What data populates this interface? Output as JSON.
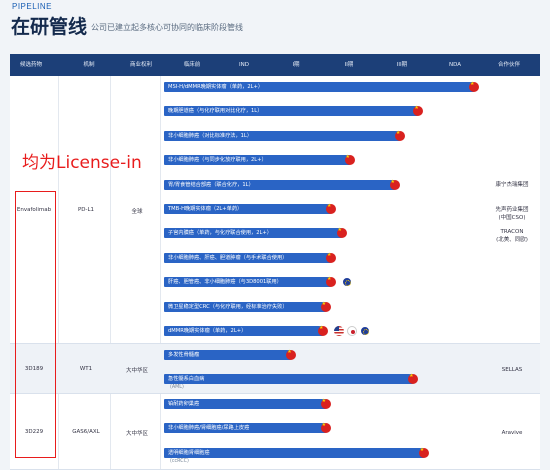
{
  "header": {
    "kicker": "PIPELINE",
    "title": "在研管线",
    "subtitle": "公司已建立起多核心可协同的临床阶段管线"
  },
  "columns": [
    "候选药物",
    "机制",
    "商业权利",
    "临床前",
    "IND",
    "I期",
    "II期",
    "III期",
    "NDA",
    "合作伙伴"
  ],
  "annotation": "均为License-in",
  "groups": [
    {
      "drug": "Envafolimab",
      "mechanism": "PD-L1",
      "rights": "全球",
      "partners": [
        "康宁杰瑞集团",
        "先声药业集团\n(中国CSO)",
        "TRACON\n(北美、同欧)"
      ],
      "bars": [
        {
          "label": "MSI-H/dMMR晚期实体瘤（单药，2L+）",
          "stage": 5.9,
          "flags": [
            "cn"
          ]
        },
        {
          "label": "晚期胆道癌（与化疗联用对比化疗，1L）",
          "stage": 4.85,
          "flags": [
            "cn"
          ]
        },
        {
          "label": "非小细胞肺癌（对比标准疗法，1L）",
          "stage": 4.5,
          "flags": [
            "cn"
          ]
        },
        {
          "label": "非小细胞肺癌（与同步化放疗联用，2L+）",
          "stage": 3.55,
          "flags": [
            "cn"
          ]
        },
        {
          "label": "胃/胃食管结合部癌（联合化疗，1L）",
          "stage": 4.4,
          "flags": [
            "cn"
          ]
        },
        {
          "label": "TMB-H晚期实体瘤（2L+单药）",
          "stage": 3.2,
          "flags": [
            "cn"
          ]
        },
        {
          "label": "子宫内膜癌（单药，与化疗联合使用，2L+）",
          "stage": 3.4,
          "flags": [
            "cn"
          ]
        },
        {
          "label": "非小细胞肺癌、肝癌、胆道肿瘤（与手术联合使用）",
          "stage": 3.2,
          "flags": [
            "cn"
          ]
        },
        {
          "label": "肝癌、胆管癌、非小细胞肺癌（与3D8001联用）",
          "stage": 3.2,
          "flags": [
            "cn",
            "eu"
          ]
        },
        {
          "label": "微卫星稳定型CRC（与化疗联用，经标准治疗失败）",
          "stage": 3.1,
          "flags": [
            "cn"
          ]
        },
        {
          "label": "dMMR晚期实体瘤（单药，2L+）",
          "stage": 3.05,
          "flags": [
            "cn",
            "us",
            "jp",
            "eu"
          ]
        }
      ]
    },
    {
      "drug": "3D189",
      "mechanism": "WT1",
      "rights": "大中华区",
      "partners": [
        "SELLAS"
      ],
      "bars": [
        {
          "label": "多发性骨髓瘤",
          "stage": 2.45,
          "flags": [
            "cn"
          ]
        },
        {
          "label": "急性髓系白血病",
          "stage": 4.75,
          "flags": [
            "cn"
          ],
          "note": "(AML)"
        }
      ]
    },
    {
      "drug": "3D229",
      "mechanism": "GAS6/AXL",
      "rights": "大中华区",
      "partners": [
        "Aravive"
      ],
      "bars": [
        {
          "label": "铂耐药卵巢癌",
          "stage": 3.1,
          "flags": [
            "cn"
          ]
        },
        {
          "label": "非小细胞肺癌/肾细胞癌/尿路上皮癌",
          "stage": 3.1,
          "flags": [
            "cn"
          ]
        },
        {
          "label": "透明细胞肾细胞癌",
          "stage": 4.95,
          "flags": [
            "cn"
          ],
          "note": "(ccRCC)"
        }
      ]
    }
  ],
  "colors": {
    "header_band": "#1c3f78",
    "bar": "#2a64c5",
    "annotation": "#e81c1c"
  }
}
